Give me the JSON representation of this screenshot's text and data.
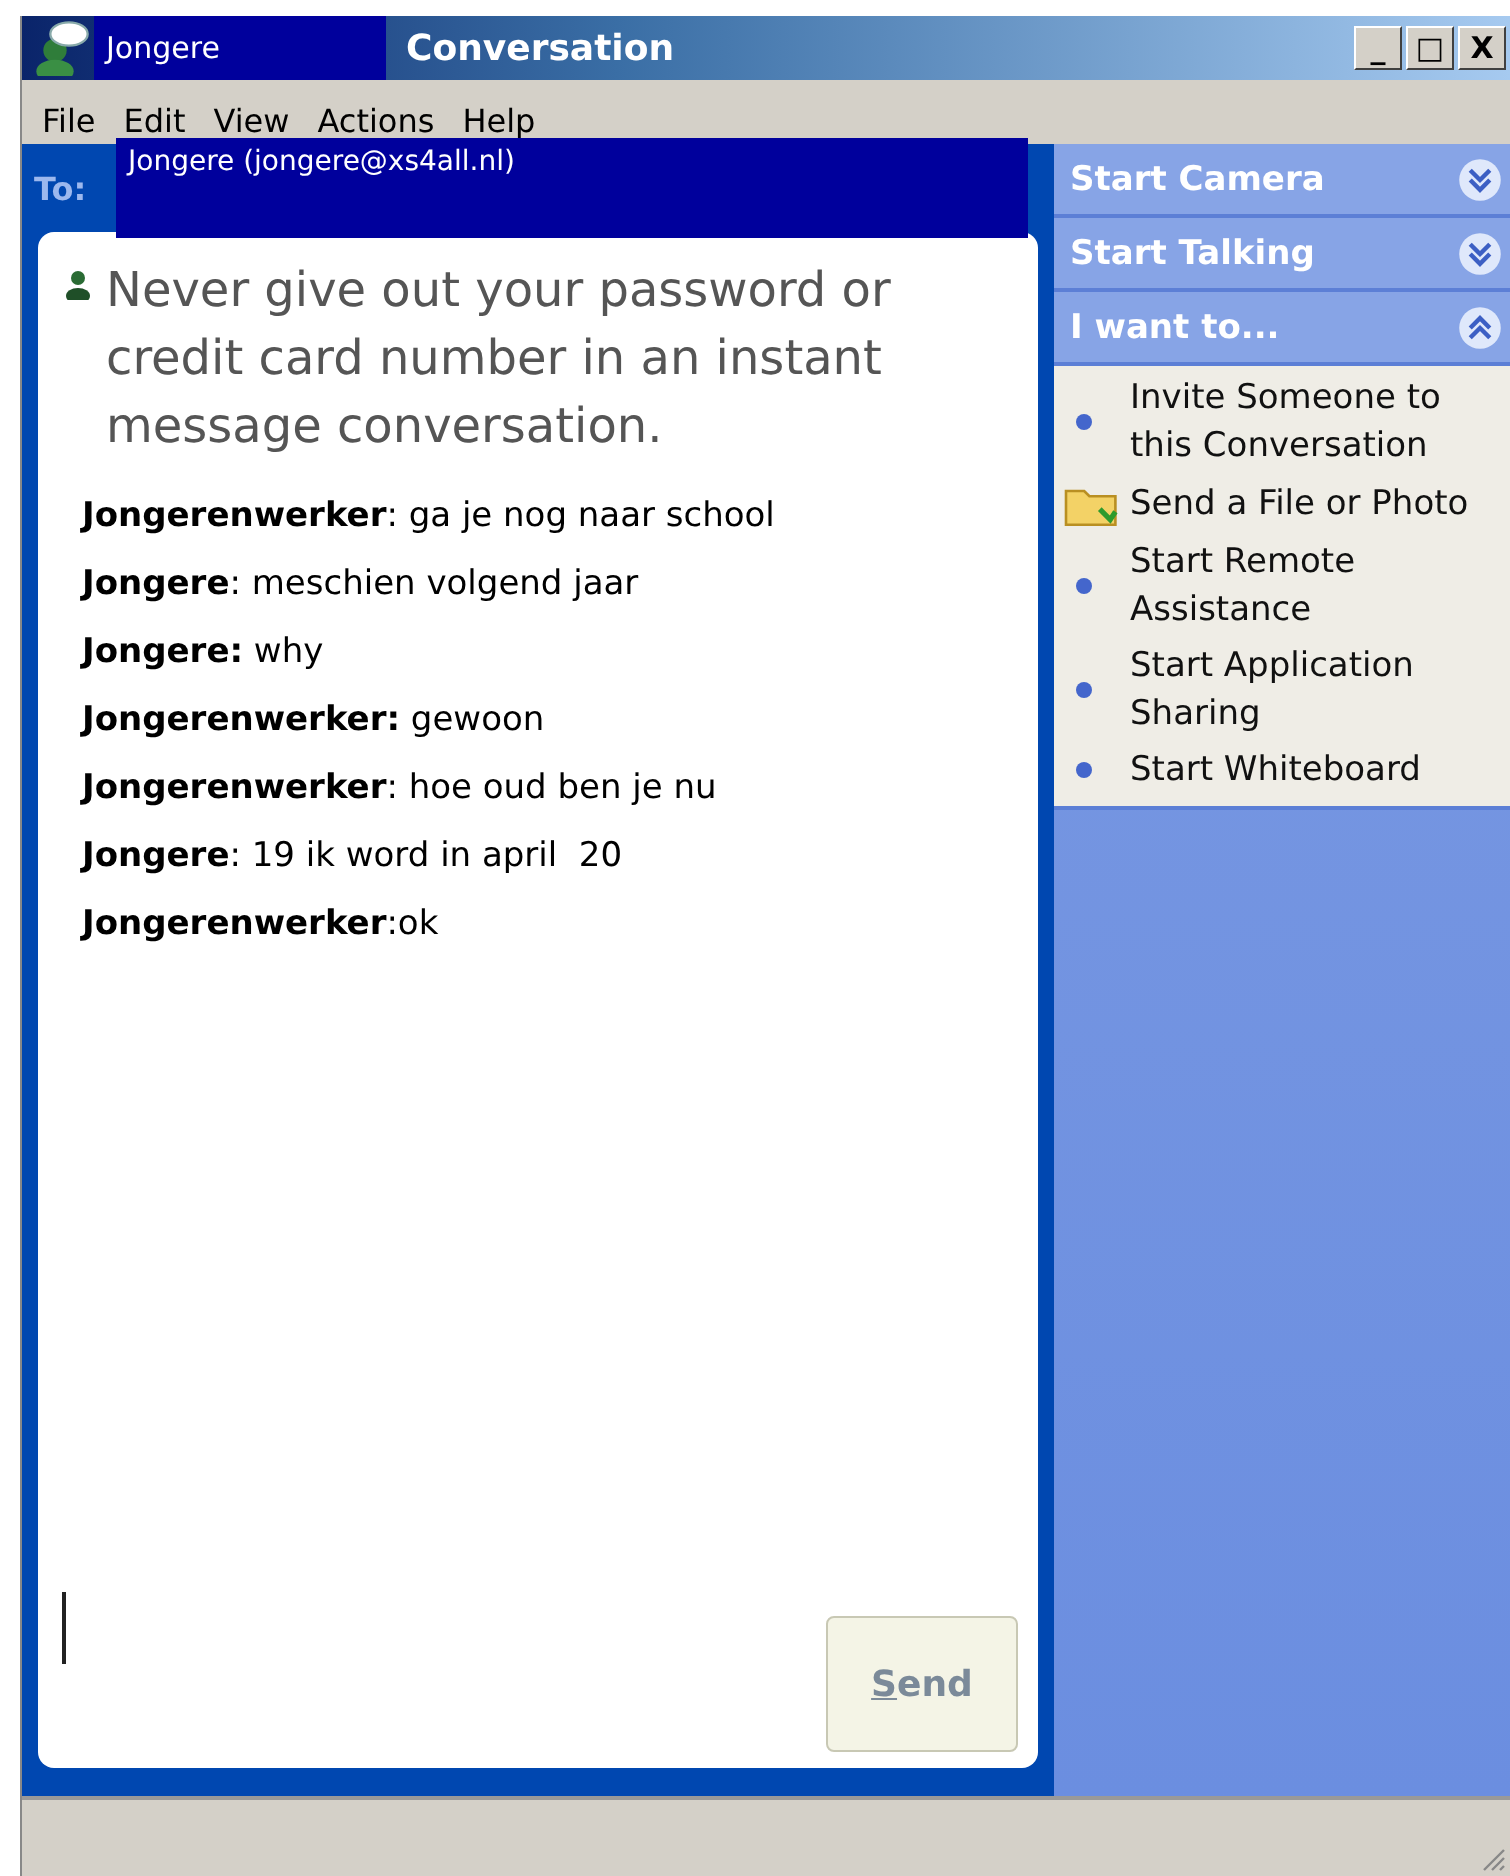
{
  "window": {
    "contact": "Jongere",
    "title": "Conversation",
    "controls": [
      "_",
      "□",
      "X"
    ]
  },
  "menu": [
    "File",
    "Edit",
    "View",
    "Actions",
    "Help"
  ],
  "to": {
    "label": "To:",
    "recipient": "Jongere (jongere@xs4all.nl)"
  },
  "warning": "Never give out your password or credit card number in an instant message conversation.",
  "messages": [
    {
      "text": "**Jongerenwerker**: ga je nog naar school"
    },
    {
      "text": "**Jongere**: meschien volgend jaar"
    },
    {
      "text": "**Jongere:** why"
    },
    {
      "text": "**Jongerenwerker:** gewoon"
    },
    {
      "text": "**Jongerenwerker**: hoe oud ben je nu"
    },
    {
      "text": "**Jongere**: 19 ik word in april  20"
    },
    {
      "text": "**Jongerenwerker**:ok"
    }
  ],
  "send_button": {
    "label": "Send",
    "disabled": true
  },
  "tasks": [
    {
      "title": "Start Camera",
      "expanded": false
    },
    {
      "title": "Start Talking",
      "expanded": false
    },
    {
      "title": "I want to...",
      "expanded": true,
      "items": [
        {
          "kind": "bullet",
          "label": "Invite Someone to this Conversation"
        },
        {
          "kind": "folder",
          "label": "Send a File or Photo"
        },
        {
          "kind": "bullet",
          "label": "Start Remote Assistance"
        },
        {
          "kind": "bullet",
          "label": "Start Application Sharing"
        },
        {
          "kind": "bullet",
          "label": "Start Whiteboard"
        }
      ]
    }
  ]
}
